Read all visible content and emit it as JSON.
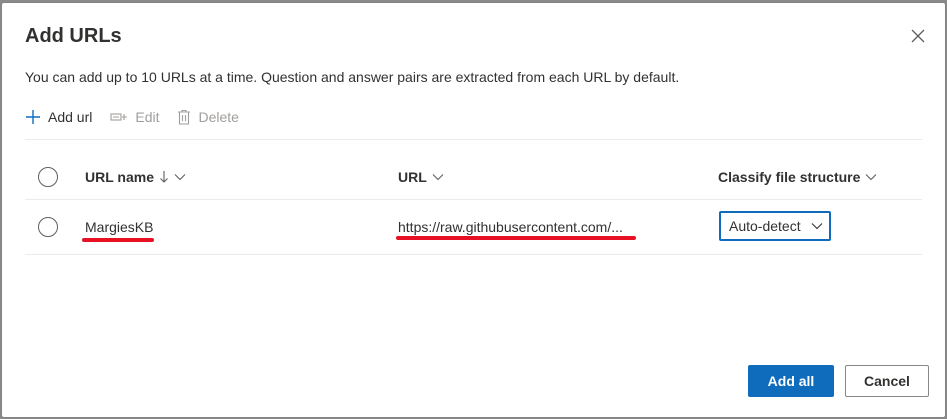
{
  "dialog": {
    "title": "Add URLs",
    "description": "You can add up to 10 URLs at a time. Question and answer pairs are extracted from each URL by default."
  },
  "toolbar": {
    "add_label": "Add url",
    "edit_label": "Edit",
    "delete_label": "Delete"
  },
  "table": {
    "columns": {
      "url_name": "URL name",
      "url": "URL",
      "classify": "Classify file structure"
    },
    "rows": [
      {
        "url_name": "MargiesKB",
        "url": "https://raw.githubusercontent.com/...",
        "classify": "Auto-detect"
      }
    ]
  },
  "footer": {
    "add_all_label": "Add all",
    "cancel_label": "Cancel"
  },
  "colors": {
    "accent": "#0f6cbd",
    "annotation": "#e81123"
  },
  "icons": [
    "close-icon",
    "plus-icon",
    "edit-icon",
    "trash-icon",
    "sort-down-arrow-icon",
    "chevron-down-icon"
  ]
}
